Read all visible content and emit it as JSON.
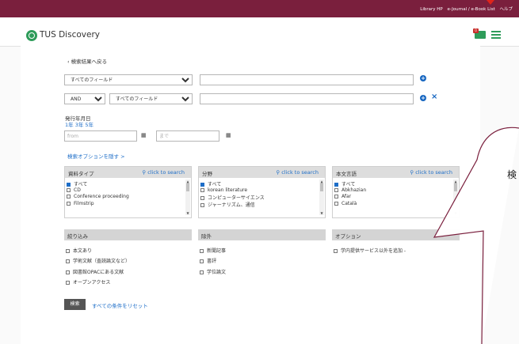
{
  "topbar": {
    "links": [
      "Library HP",
      "e-Journal / e-Book List",
      "ヘルプ"
    ]
  },
  "header": {
    "title": "TUS Discovery",
    "folder_count": "0"
  },
  "icons": {
    "logo": "circle-logo-icon",
    "folder": "folder-icon",
    "menu": "hamburger-menu-icon",
    "add": "plus-circle-icon",
    "remove": "x-icon",
    "calendar": "calendar-icon",
    "search": "magnifier-icon"
  },
  "nav": {
    "back": "‹ 検索結果へ戻る"
  },
  "query": {
    "row1_field": "すべてのフィールド",
    "row2_operator": "AND",
    "row2_field": "すべてのフィールド"
  },
  "date": {
    "label": "発行年月日",
    "quick_links": "1年 3年 5年",
    "from_placeholder": "from",
    "to_placeholder": "まで"
  },
  "options_toggle": "検索オプションを隠す >",
  "search_link_label": "click to search",
  "facets": [
    {
      "title": "資料タイプ",
      "items": [
        {
          "label": "すべて",
          "checked": true
        },
        {
          "label": "CD",
          "checked": false
        },
        {
          "label": "Conference proceeding",
          "checked": false
        },
        {
          "label": "Filmstrip",
          "checked": false
        }
      ]
    },
    {
      "title": "分野",
      "items": [
        {
          "label": "すべて",
          "checked": true
        },
        {
          "label": "korean literature",
          "checked": false
        },
        {
          "label": "コンピューターサイエンス",
          "checked": false
        },
        {
          "label": "ジャーナリズム、通信",
          "checked": false
        }
      ]
    },
    {
      "title": "本文言語",
      "items": [
        {
          "label": "すべて",
          "checked": true
        },
        {
          "label": "Abkhazian",
          "checked": false
        },
        {
          "label": "Afar",
          "checked": false
        },
        {
          "label": "Català",
          "checked": false
        }
      ]
    }
  ],
  "filters": {
    "narrow_title": "絞り込み",
    "narrow_items": [
      "本文あり",
      "学術文献（査読論文など）",
      "図書館OPACにある文献",
      "オープンアクセス"
    ],
    "exclude_title": "除外",
    "exclude_items": [
      "新聞記事",
      "書評",
      "学位論文"
    ],
    "option_title": "オプション",
    "option_items": [
      "学内提供サービス以外を追加 -"
    ]
  },
  "actions": {
    "search": "検索",
    "reset": "すべての条件をリセット"
  },
  "callout": {
    "text": "検"
  },
  "colors": {
    "brand": "#7a1f3d",
    "accent": "#2e9c5a",
    "link": "#1e6ec8",
    "callout_border": "#7a1f3d"
  }
}
